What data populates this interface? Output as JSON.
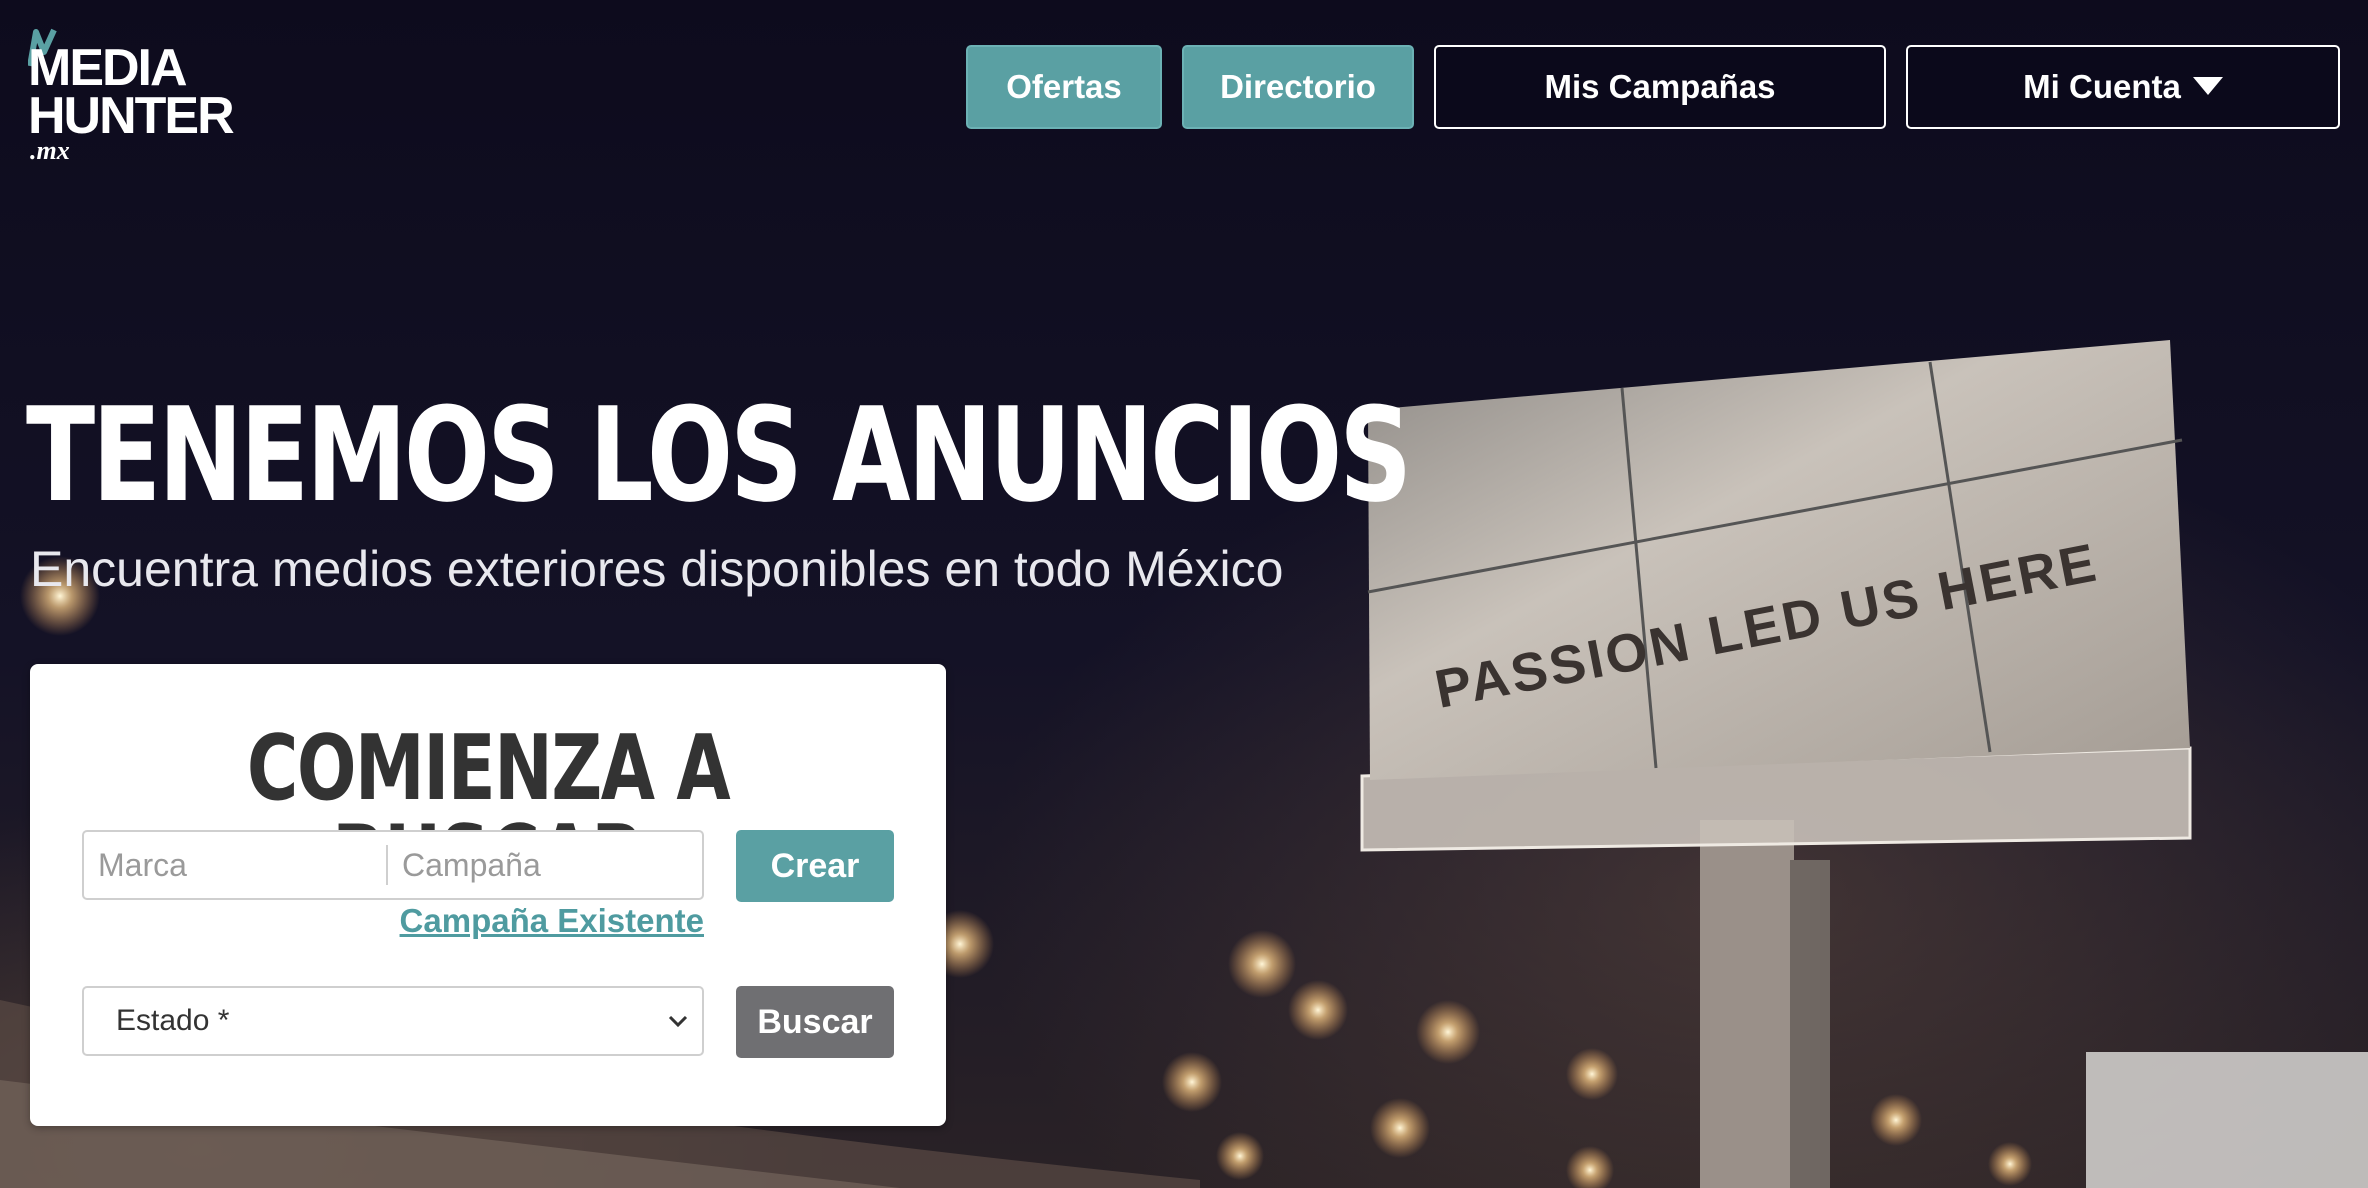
{
  "logo": {
    "line1": "MEDIA",
    "line2": "HUNTER",
    "line3": ".mx"
  },
  "nav": {
    "ofertas": "Ofertas",
    "directorio": "Directorio",
    "mis_campanas": "Mis Campañas",
    "mi_cuenta": "Mi Cuenta"
  },
  "hero": {
    "headline": "TENEMOS LOS ANUNCIOS",
    "subheadline": "Encuentra medios exteriores disponibles en todo México",
    "billboard_text": "PASSION LED US HERE"
  },
  "search": {
    "title": "COMIENZA A BUSCAR",
    "marca_placeholder": "Marca",
    "campana_placeholder": "Campaña",
    "crear_label": "Crear",
    "existing_link": "Campaña Existente",
    "estado_value": "Estado *",
    "buscar_label": "Buscar"
  },
  "colors": {
    "accent": "#5aa0a3",
    "link": "#4f9ba0",
    "button_gray": "#6f6f72",
    "background": "#0e0c1d"
  },
  "icons": {
    "caret": "caret-down-icon",
    "select_chevron": "chevron-down-icon"
  }
}
